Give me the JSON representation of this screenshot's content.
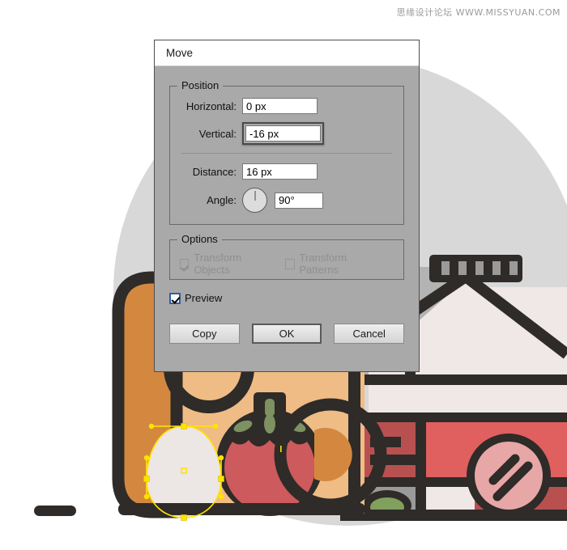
{
  "watermark": {
    "text": "思缘设计论坛  WWW.MISSYUAN.COM"
  },
  "dialog": {
    "title": "Move",
    "position_group": {
      "legend": "Position",
      "horizontal_label": "Horizontal:",
      "horizontal_value": "0 px",
      "vertical_label": "Vertical:",
      "vertical_value": "-16 px",
      "distance_label": "Distance:",
      "distance_value": "16 px",
      "angle_label": "Angle:",
      "angle_value": "90°"
    },
    "options_group": {
      "legend": "Options",
      "transform_objects_label": "Transform Objects",
      "transform_objects_checked": true,
      "transform_objects_enabled": false,
      "transform_patterns_label": "Transform Patterns",
      "transform_patterns_checked": false,
      "transform_patterns_enabled": false
    },
    "preview_label": "Preview",
    "preview_checked": true,
    "buttons": {
      "copy": "Copy",
      "ok": "OK",
      "cancel": "Cancel"
    }
  },
  "artwork": {
    "description": "Flat vector illustration of a lunch box with egg, tomato and a house behind, shown in Adobe Illustrator canvas",
    "colors": {
      "outline": "#2e2b29",
      "backdrop_circle": "#d8d8d8",
      "orange_lid": "#d4883f",
      "box_interior": "#efbc85",
      "egg": "#ece6e5",
      "tomato": "#cd5a5c",
      "tomato_leaf": "#7d9161",
      "house_wall": "#efe8e7",
      "house_roof_shadow": "#b3b3b3",
      "grey_panel": "#9a9a9a",
      "red_panel": "#b95050",
      "red_panel_light": "#e05f5f",
      "pink_circle": "#e8a7a7",
      "olive": "#81a05d",
      "selection": "#ffe400"
    }
  }
}
